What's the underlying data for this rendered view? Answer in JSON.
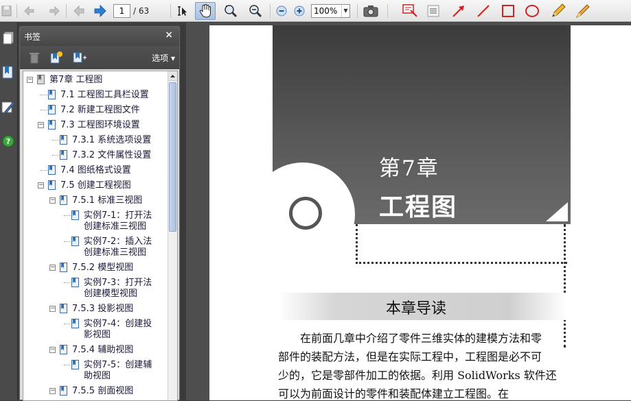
{
  "toolbar": {
    "page_current": "1",
    "page_total": "/ 63",
    "zoom": "100%",
    "icons": [
      "save-icon",
      "back-icon",
      "forward-icon",
      "prev-page-icon",
      "next-page-icon",
      "select-tool-icon",
      "hand-tool-icon",
      "zoom-in-tool-icon",
      "zoom-out-tool-icon",
      "zoom-out-icon",
      "zoom-in-icon",
      "snapshot-icon",
      "comment-icon",
      "note-icon",
      "arrow-tool-icon",
      "line-tool-icon",
      "rectangle-tool-icon",
      "oval-tool-icon",
      "pencil-icon",
      "highlighter-icon"
    ]
  },
  "bookmarks_panel": {
    "title": "书签",
    "close": "×",
    "options": "选项 ▾",
    "items": [
      {
        "label": "第7章 工程图",
        "level": 0,
        "toggle": "−"
      },
      {
        "label": "7.1 工程图工具栏设置",
        "level": 1,
        "toggle": ""
      },
      {
        "label": "7.2 新建工程图文件",
        "level": 1,
        "toggle": ""
      },
      {
        "label": "7.3 工程图环境设置",
        "level": 1,
        "toggle": "−"
      },
      {
        "label": "7.3.1 系统选项设置",
        "level": 2,
        "toggle": ""
      },
      {
        "label": "7.3.2 文件属性设置",
        "level": 2,
        "toggle": ""
      },
      {
        "label": "7.4 图纸格式设置",
        "level": 1,
        "toggle": ""
      },
      {
        "label": "7.5 创建工程视图",
        "level": 1,
        "toggle": "−"
      },
      {
        "label": "7.5.1 标准三视图",
        "level": 2,
        "toggle": "−"
      },
      {
        "label": "实例7-1：打开法\n创建标准三视图",
        "level": 3,
        "toggle": ""
      },
      {
        "label": "实例7-2：插入法\n创建标准三视图",
        "level": 3,
        "toggle": ""
      },
      {
        "label": "7.5.2 模型视图",
        "level": 2,
        "toggle": "−"
      },
      {
        "label": "实例7-3：打开法\n创建模型视图",
        "level": 3,
        "toggle": ""
      },
      {
        "label": "7.5.3 投影视图",
        "level": 2,
        "toggle": "−"
      },
      {
        "label": "实例7-4：创建投\n影视图",
        "level": 3,
        "toggle": ""
      },
      {
        "label": "7.5.4 辅助视图",
        "level": 2,
        "toggle": "−"
      },
      {
        "label": "实例7-5：创建辅\n助视图",
        "level": 3,
        "toggle": ""
      },
      {
        "label": "7.5.5 剖面视图",
        "level": 2,
        "toggle": "−"
      }
    ]
  },
  "document": {
    "chapter_number": "第7章",
    "chapter_title": "工程图",
    "section_title": "本章导读",
    "paragraph_lines": [
      "在前面几章中介绍了零件三维实体的建模方法和零",
      "部件的装配方法，但是在实际工程中，工程图是必不可",
      "少的，它是零部件加工的依据。利用 SolidWorks 软件还",
      "可以为前面设计的零件和装配体建立工程图。在"
    ]
  },
  "colors": {
    "accent_blue": "#2f6fb3",
    "annotation_red": "#d42020",
    "pencil_yellow": "#f0b830",
    "panel_dark": "#4a4a4a"
  }
}
